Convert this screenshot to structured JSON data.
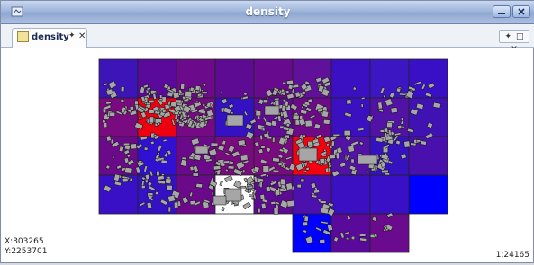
{
  "window": {
    "title": "density"
  },
  "tab": {
    "label": "density",
    "pin_glyph": "✦",
    "close_glyph": "✕"
  },
  "panel_controls": {
    "pin": "✦",
    "maximize": "□",
    "close": "✕"
  },
  "status": {
    "x_label": "X:303265",
    "y_label": "Y:2253701",
    "scale": "1:24165"
  },
  "map": {
    "rows": 5,
    "cols": 9,
    "cells": [
      [
        "#3c14b8",
        "#5a0a9a",
        "#6c0a8c",
        "#5e0b94",
        "#680a8e",
        "#60109a",
        "#3a10c2",
        "#3c16c2",
        "#3a10c6"
      ],
      [
        "#7a0a80",
        "#ee0010",
        "#760a84",
        "#3412c4",
        "#600b96",
        "#6c0a8a",
        "#3a10c0",
        "#5212a6",
        "#4012b4"
      ],
      [
        "#6a0a8a",
        "#3010d2",
        "#6a0a8a",
        "#7a0a80",
        "#7a0a80",
        "#f60010",
        "#5212a6",
        "#3412c0",
        "#4a10ae"
      ],
      [
        "#3a10c6",
        "#3412c4",
        "#6a0a8a",
        "#ffffff",
        "#5e0b94",
        "#4c10ae",
        "#3a10c2",
        "#3a10c6",
        "#0000ff"
      ],
      [
        null,
        null,
        null,
        null,
        null,
        "#0000ff",
        "#5a0a9a",
        "#6a0a8c",
        null
      ]
    ]
  }
}
